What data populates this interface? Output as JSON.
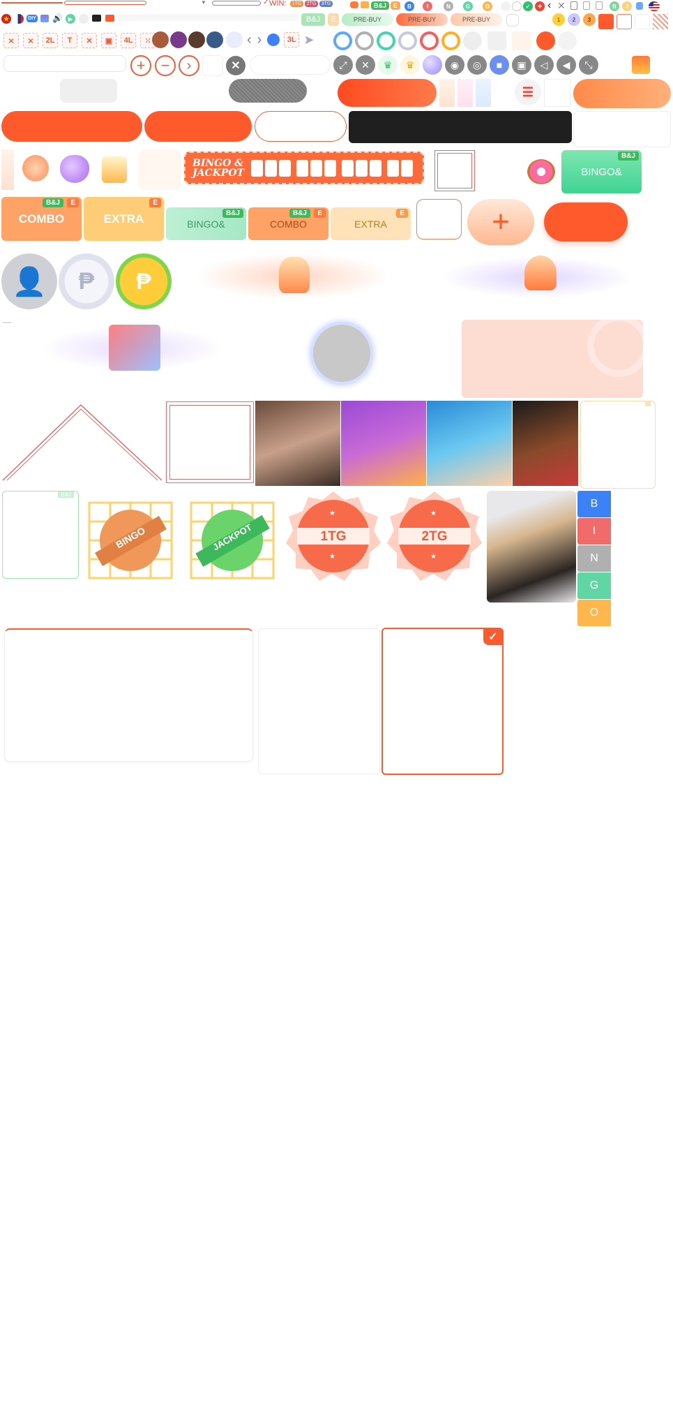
{
  "top": {
    "win_label": "WIN:",
    "prize_1": "1TG",
    "prize_2": "2TG",
    "prize_3": "3TG",
    "badge_bj": "B&J",
    "badge_e": "E",
    "bingo_letters_small": [
      "B",
      "I",
      "N",
      "G",
      "O"
    ],
    "pre_buy": "PRE-BUY"
  },
  "row2": {
    "diy_label": "DIY",
    "tile_2l": "2L",
    "tile_4l": "4L",
    "tile_3l": "3L"
  },
  "banner": {
    "line1": "BINGO &",
    "line2": "JACKPOT"
  },
  "tickets": {
    "bingo_amp": "BINGO&",
    "combo": "COMBO",
    "extra": "EXTRA",
    "tag_bj": "B&J",
    "tag_e": "E"
  },
  "seals": {
    "bingo": "BINGO",
    "jackpot": "JACKPOT",
    "tg1": "1TG",
    "tg2": "2TG"
  },
  "card_tag": "B&J",
  "bingo_column": [
    "B",
    "I",
    "N",
    "G",
    "O"
  ],
  "colors": {
    "primary": "#ff5a2c",
    "orange_light": "#ffa26b",
    "green": "#3dbb5c",
    "blue": "#3b82f6",
    "red": "#f26b6b",
    "grey": "#b0b0b0",
    "teal": "#5fd6a4",
    "yellow": "#ffb74d"
  }
}
